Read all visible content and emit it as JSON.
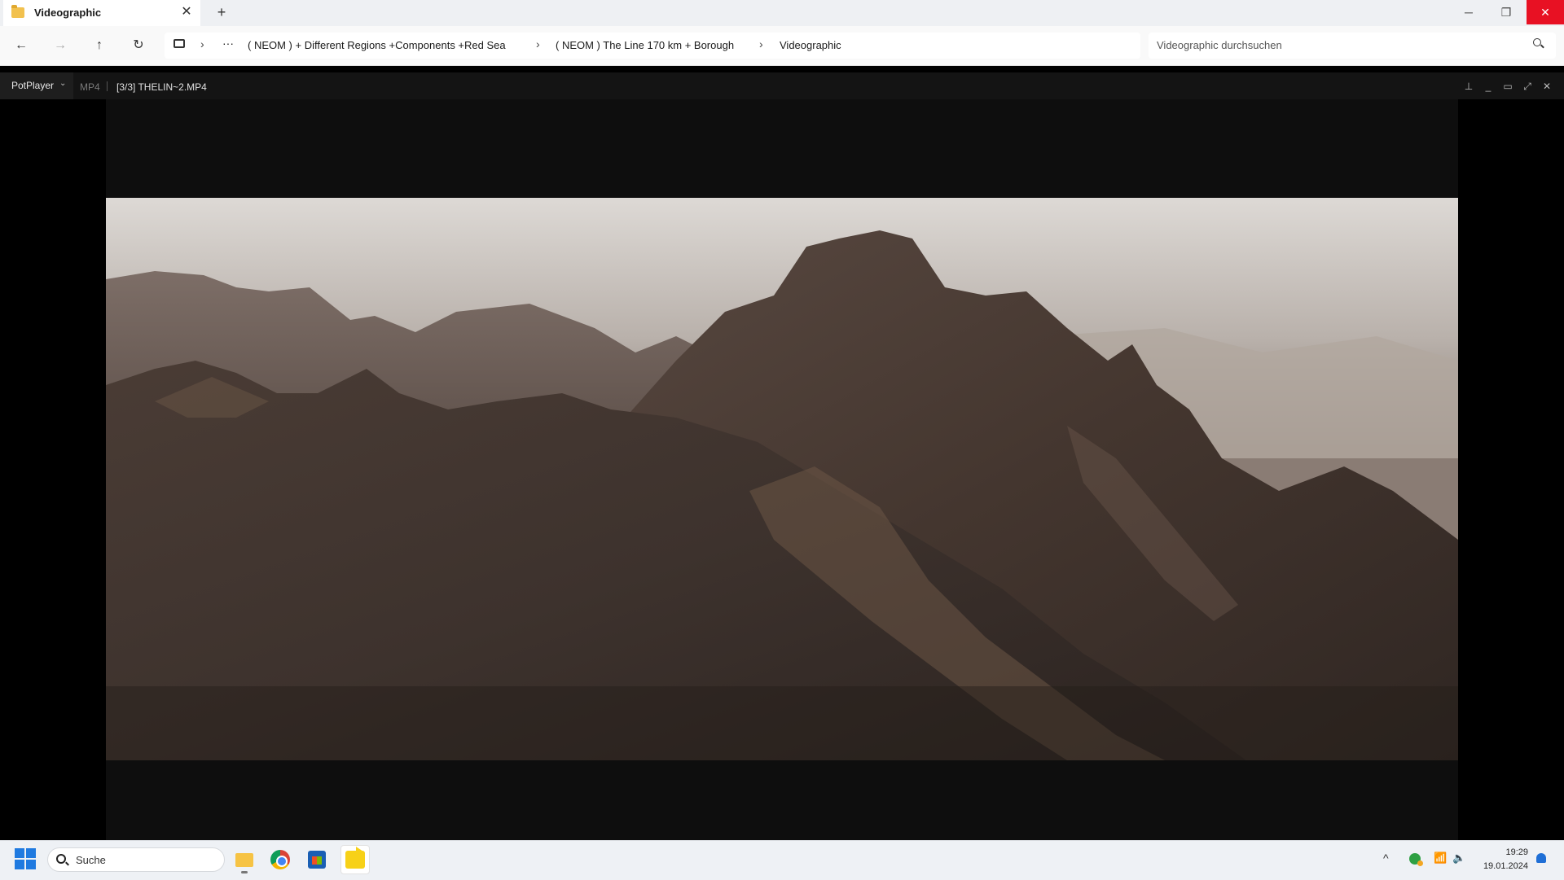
{
  "explorer": {
    "tab_title": "Videographic",
    "tab_close_glyph": "✕",
    "new_tab_glyph": "+",
    "window_controls": {
      "minimize": "─",
      "maximize": "❐",
      "close": "✕"
    },
    "nav": {
      "back": "←",
      "forward": "→",
      "up": "↑",
      "refresh": "↻"
    },
    "breadcrumb": {
      "overflow": "···",
      "separator": "›",
      "items": [
        "( NEOM ) + Different Regions +Components +Red Sea",
        "( NEOM ) The Line 170 km + Borough",
        "Videographic"
      ]
    },
    "search_placeholder": "Videographic durchsuchen"
  },
  "potplayer": {
    "menu_label": "PotPlayer",
    "menu_caret": "⌄",
    "format": "MP4",
    "file_label": "[3/3] THELIN~2.MP4",
    "controls": {
      "pin": "⊥",
      "minimize": "_",
      "maximize": "▭",
      "fullscreen": "⤢",
      "close": "✕"
    },
    "frame_colors": {
      "sky": "#d9d6d2",
      "rock": "#3a2f2a"
    }
  },
  "taskbar": {
    "search_label": "Suche",
    "tray": {
      "overflow": "^",
      "wifi": "📶",
      "volume": "🔈",
      "time": "19:29",
      "date": "19.01.2024"
    },
    "icons": [
      "windows-start-icon",
      "search-icon",
      "file-explorer-icon",
      "chrome-icon",
      "microsoft-store-icon",
      "potplayer-icon"
    ]
  },
  "colors": {
    "close_red": "#e81123",
    "start_blue": "#1f7ae0",
    "folder_yellow": "#f6c344",
    "potplayer_yellow": "#f7d117"
  }
}
